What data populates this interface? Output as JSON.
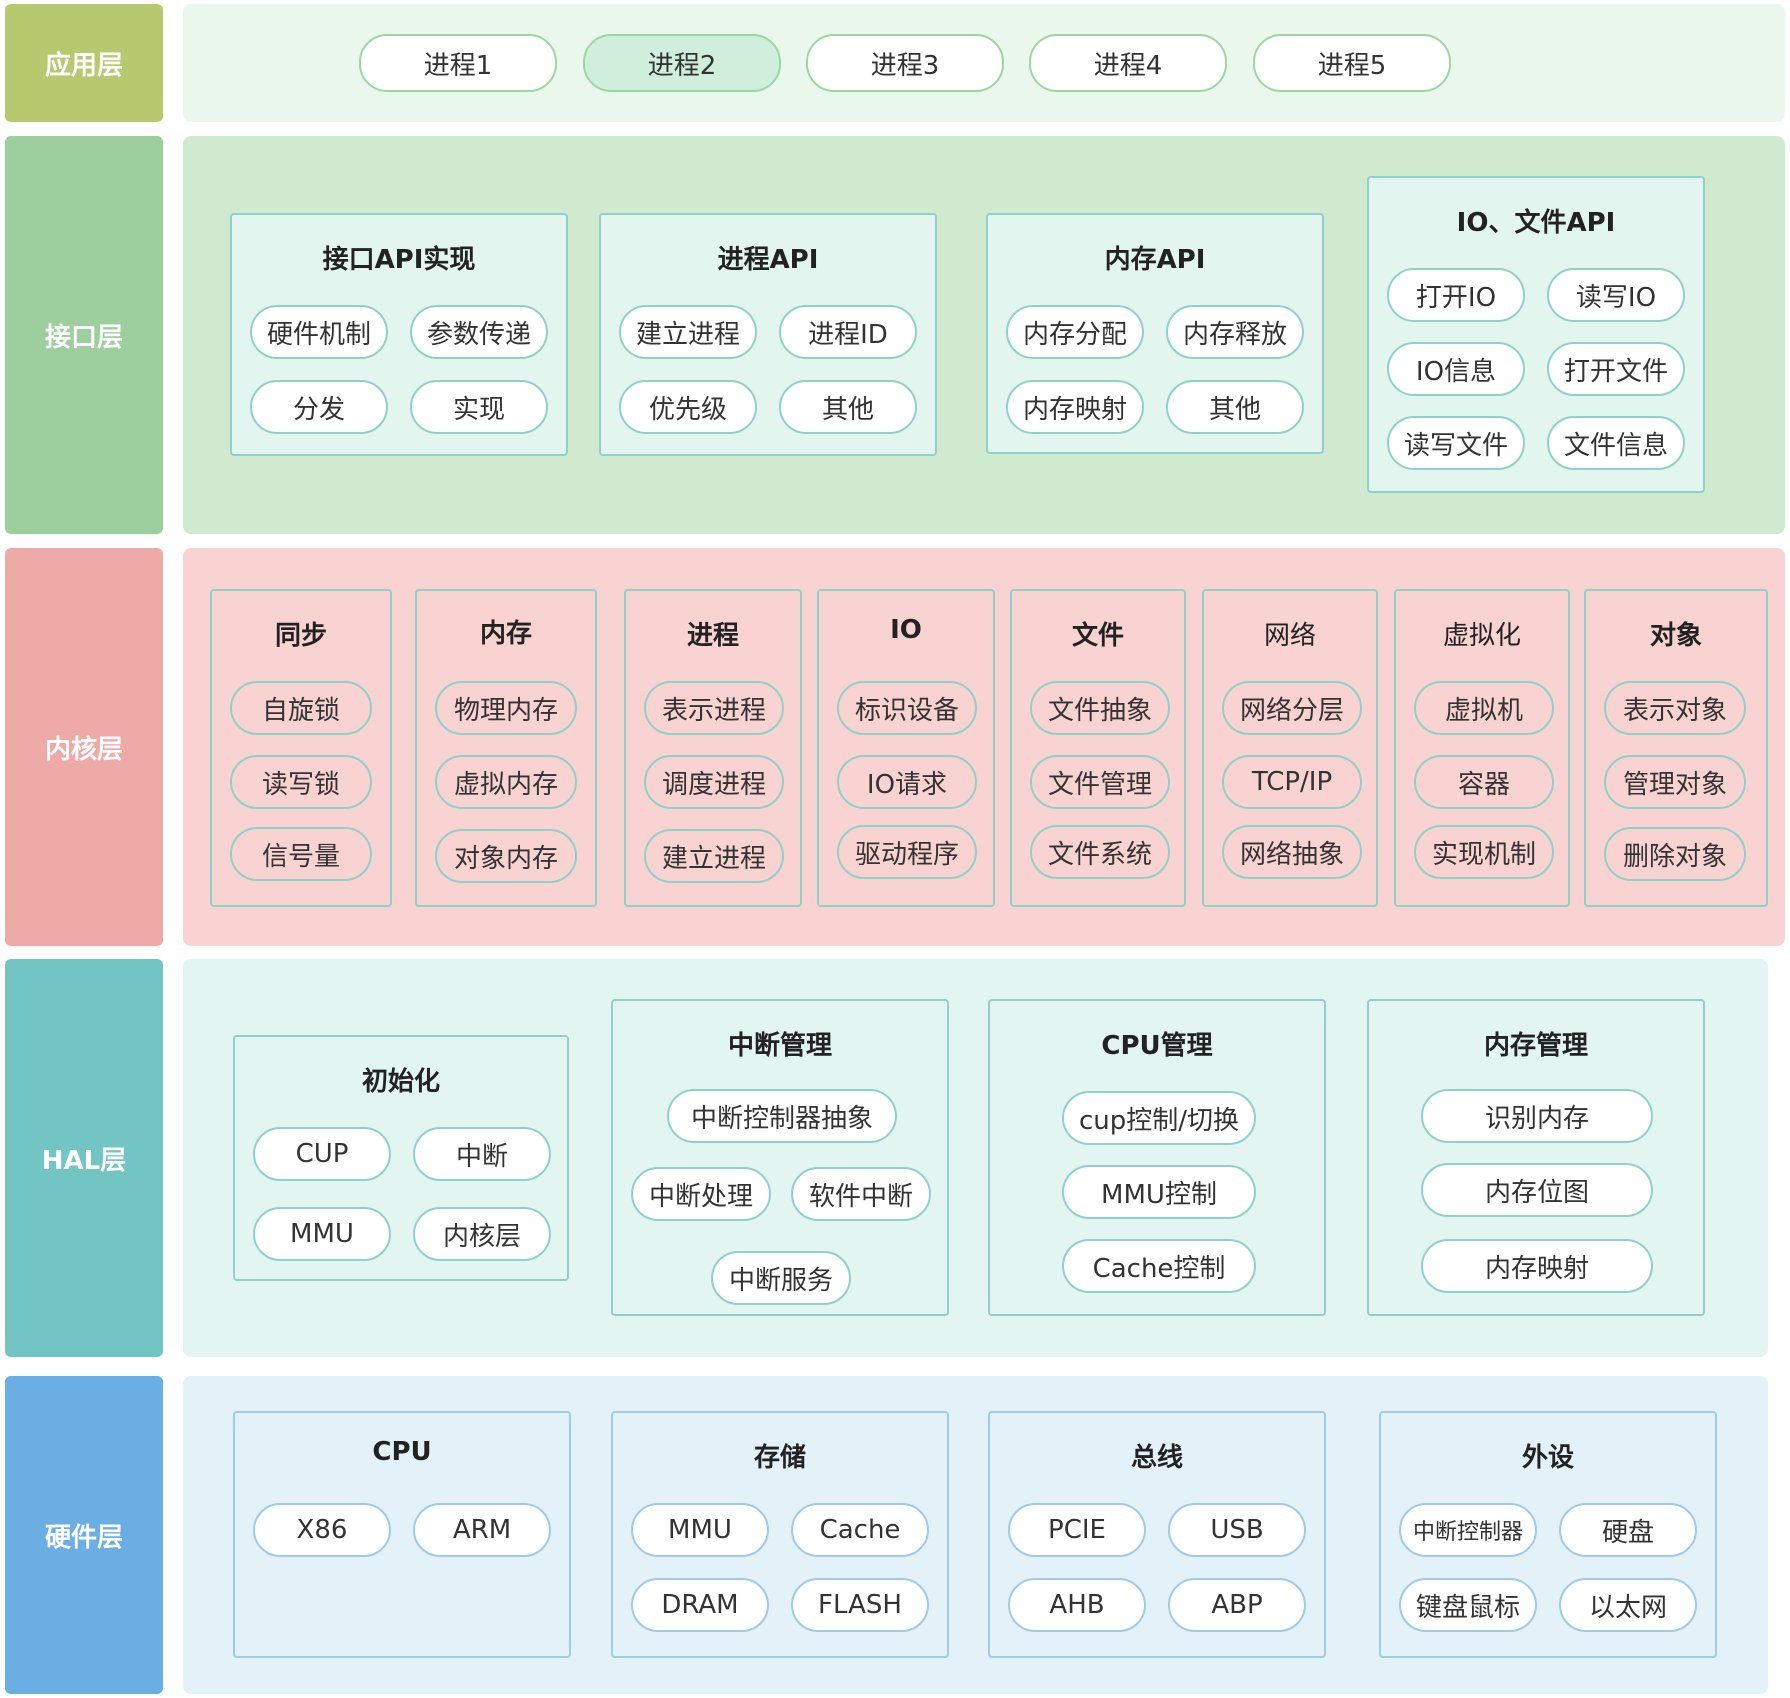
{
  "layers": {
    "app": {
      "label": "应用层",
      "label_color": "#b6c96e",
      "bg_color": "#eaf7ec"
    },
    "interface": {
      "label": "接口层",
      "label_color": "#9ccf9d",
      "bg_color": "#cfeacf"
    },
    "kernel": {
      "label": "内核层",
      "label_color": "#eeaaa6",
      "bg_color": "#f9d3d1"
    },
    "hal": {
      "label": "HAL层",
      "label_color": "#72c5c2",
      "bg_color": "#e3f5f1"
    },
    "hardware": {
      "label": "硬件层",
      "label_color": "#6aaee3",
      "bg_color": "#e3f1f9"
    }
  },
  "app": {
    "processes": [
      "进程1",
      "进程2",
      "进程3",
      "进程4",
      "进程5"
    ]
  },
  "interface": {
    "groups": [
      {
        "title": "接口API实现",
        "items": [
          "硬件机制",
          "参数传递",
          "分发",
          "实现"
        ]
      },
      {
        "title": "进程API",
        "items": [
          "建立进程",
          "进程ID",
          "优先级",
          "其他"
        ]
      },
      {
        "title": "内存API",
        "items": [
          "内存分配",
          "内存释放",
          "内存映射",
          "其他"
        ]
      },
      {
        "title": "IO、文件API",
        "items": [
          "打开IO",
          "读写IO",
          "IO信息",
          "打开文件",
          "读写文件",
          "文件信息"
        ]
      }
    ]
  },
  "kernel": {
    "groups": [
      {
        "title": "同步",
        "items": [
          "自旋锁",
          "读写锁",
          "信号量"
        ]
      },
      {
        "title": "内存",
        "items": [
          "物理内存",
          "虚拟内存",
          "对象内存"
        ]
      },
      {
        "title": "进程",
        "items": [
          "表示进程",
          "调度进程",
          "建立进程"
        ]
      },
      {
        "title": "IO",
        "items": [
          "标识设备",
          "IO请求",
          "驱动程序"
        ]
      },
      {
        "title": "文件",
        "items": [
          "文件抽象",
          "文件管理",
          "文件系统"
        ]
      },
      {
        "title": "网络",
        "items": [
          "网络分层",
          "TCP/IP",
          "网络抽象"
        ]
      },
      {
        "title": "虚拟化",
        "items": [
          "虚拟机",
          "容器",
          "实现机制"
        ]
      },
      {
        "title": "对象",
        "items": [
          "表示对象",
          "管理对象",
          "删除对象"
        ]
      }
    ]
  },
  "hal": {
    "groups": [
      {
        "title": "初始化",
        "items": [
          "CUP",
          "中断",
          "MMU",
          "内核层"
        ]
      },
      {
        "title": "中断管理",
        "items": [
          "中断控制器抽象",
          "中断处理",
          "软件中断",
          "中断服务"
        ]
      },
      {
        "title": "CPU管理",
        "items": [
          "cup控制/切换",
          "MMU控制",
          "Cache控制"
        ]
      },
      {
        "title": "内存管理",
        "items": [
          "识别内存",
          "内存位图",
          "内存映射"
        ]
      }
    ]
  },
  "hardware": {
    "groups": [
      {
        "title": "CPU",
        "items": [
          "X86",
          "ARM"
        ]
      },
      {
        "title": "存储",
        "items": [
          "MMU",
          "Cache",
          "DRAM",
          "FLASH"
        ]
      },
      {
        "title": "总线",
        "items": [
          "PCIE",
          "USB",
          "AHB",
          "ABP"
        ]
      },
      {
        "title": "外设",
        "items": [
          "中断控制器",
          "硬盘",
          "键盘鼠标",
          "以太网"
        ]
      }
    ]
  }
}
